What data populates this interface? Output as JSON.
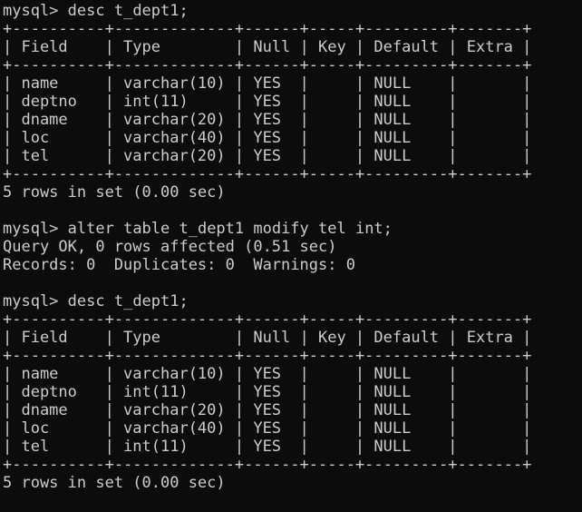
{
  "terminal": {
    "prompt": "mysql>",
    "cmd1": "desc t_dept1;",
    "table_border": "+----------+-------------+------+-----+---------+-------+",
    "table_header": "| Field    | Type        | Null | Key | Default | Extra |",
    "table1_rows": [
      "| name     | varchar(10) | YES  |     | NULL    |       |",
      "| deptno   | int(11)     | YES  |     | NULL    |       |",
      "| dname    | varchar(20) | YES  |     | NULL    |       |",
      "| loc      | varchar(40) | YES  |     | NULL    |       |",
      "| tel      | varchar(20) | YES  |     | NULL    |       |"
    ],
    "result1": "5 rows in set (0.00 sec)",
    "cmd2": "alter table t_dept1 modify tel int;",
    "query_ok": "Query OK, 0 rows affected (0.51 sec)",
    "records": "Records: 0  Duplicates: 0  Warnings: 0",
    "cmd3": "desc t_dept1;",
    "table2_rows": [
      "| name     | varchar(10) | YES  |     | NULL    |       |",
      "| deptno   | int(11)     | YES  |     | NULL    |       |",
      "| dname    | varchar(20) | YES  |     | NULL    |       |",
      "| loc      | varchar(40) | YES  |     | NULL    |       |",
      "| tel      | int(11)     | YES  |     | NULL    |       |"
    ],
    "result2": "5 rows in set (0.00 sec)"
  },
  "colors": {
    "background": "#0c0c0c",
    "foreground": "#cccccc"
  }
}
